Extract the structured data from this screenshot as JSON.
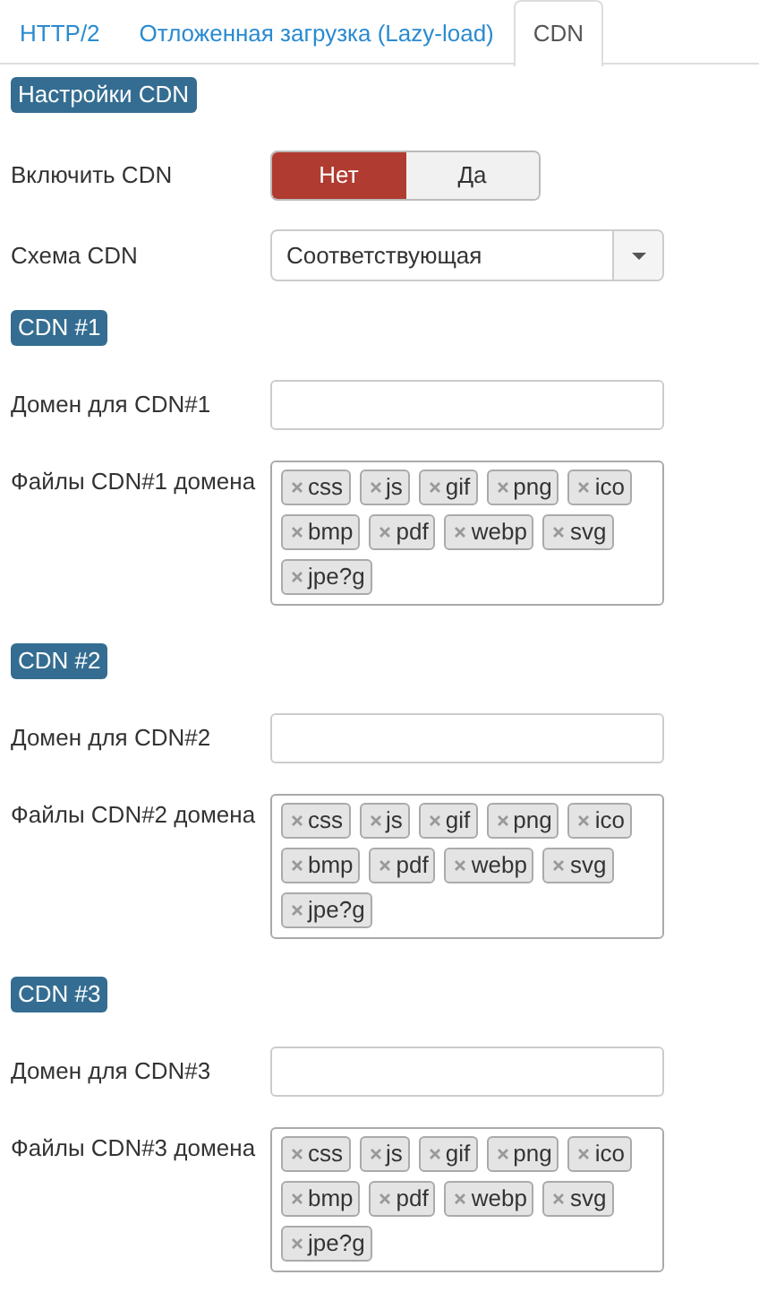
{
  "tabs": [
    {
      "label": "HTTP/2",
      "selected": false
    },
    {
      "label": "Отложенная загрузка (Lazy-load)",
      "selected": false
    },
    {
      "label": "CDN",
      "selected": true
    }
  ],
  "settings": {
    "heading": "Настройки CDN",
    "enable": {
      "label": "Включить CDN",
      "options": [
        {
          "label": "Нет",
          "selected": true
        },
        {
          "label": "Да",
          "selected": false
        }
      ]
    },
    "scheme": {
      "label": "Схема CDN",
      "value": "Соответствующая"
    }
  },
  "cdns": [
    {
      "heading": "CDN #1",
      "domain_label": "Домен для CDN#1",
      "files_label": "Файлы CDN#1 домена",
      "tags": [
        "css",
        "js",
        "gif",
        "png",
        "ico",
        "bmp",
        "pdf",
        "webp",
        "svg",
        "jpe?g"
      ]
    },
    {
      "heading": "CDN #2",
      "domain_label": "Домен для CDN#2",
      "files_label": "Файлы CDN#2 домена",
      "tags": [
        "css",
        "js",
        "gif",
        "png",
        "ico",
        "bmp",
        "pdf",
        "webp",
        "svg",
        "jpe?g"
      ]
    },
    {
      "heading": "CDN #3",
      "domain_label": "Домен для CDN#3",
      "files_label": "Файлы CDN#3 домена",
      "tags": [
        "css",
        "js",
        "gif",
        "png",
        "ico",
        "bmp",
        "pdf",
        "webp",
        "svg",
        "jpe?g"
      ]
    }
  ]
}
